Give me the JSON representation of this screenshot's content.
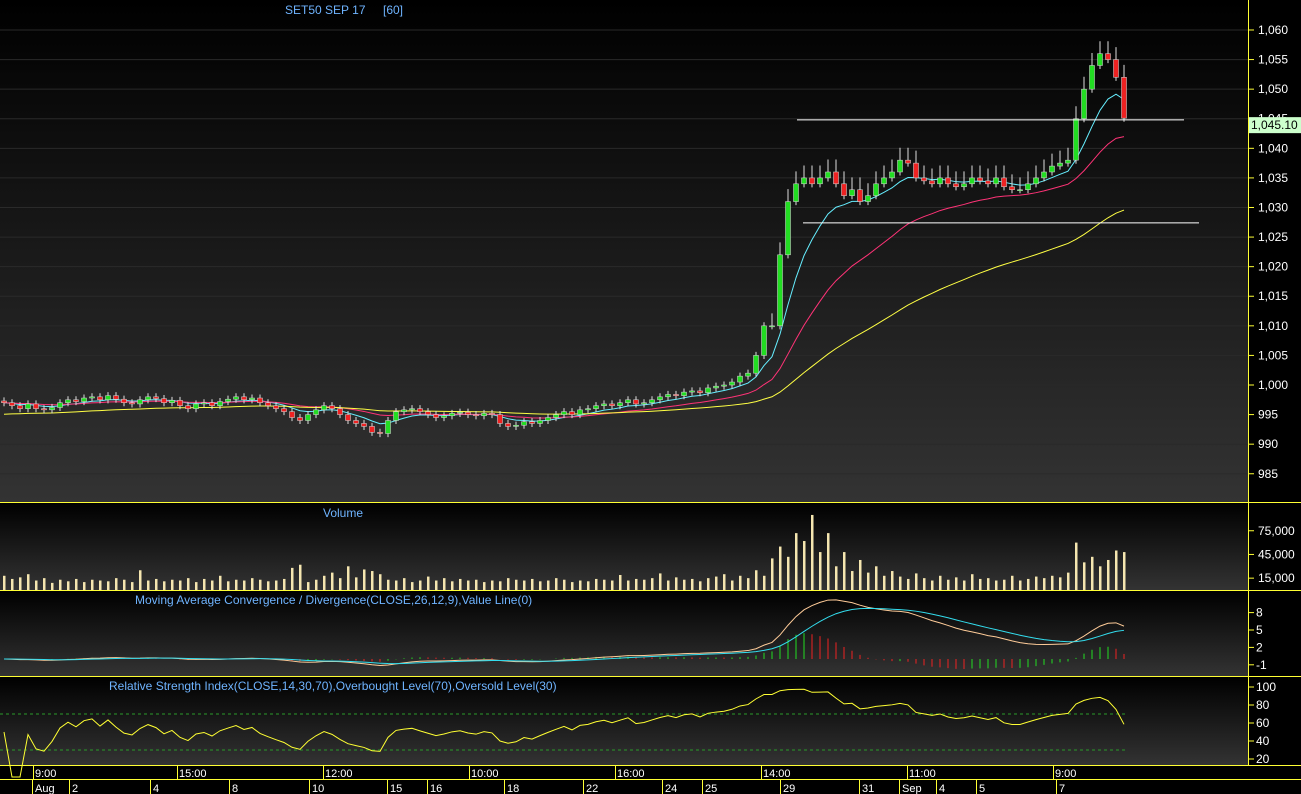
{
  "chart_data": {
    "type": "candlestick",
    "title": "SET50 SEP 17",
    "interval": "[60]",
    "price_axis": {
      "ticks": [
        "1,060",
        "1,055",
        "1,050",
        "1,045",
        "1,040",
        "1,035",
        "1,030",
        "1,025",
        "1,020",
        "1,015",
        "1,010",
        "1,005",
        "1,000",
        "995",
        "990",
        "985"
      ],
      "range": [
        978,
        1065
      ]
    },
    "last_price_label": "1,045.10",
    "last_price": 1045.1,
    "horizontal_lines": [
      1044.8,
      1027.4
    ],
    "closes": [
      997,
      996.5,
      996,
      996.8,
      996,
      995.8,
      996.2,
      997,
      997.5,
      997.2,
      997.8,
      998,
      997.5,
      998.2,
      997.6,
      997,
      996.8,
      997.5,
      998,
      997.7,
      997,
      997.4,
      996.5,
      996,
      996.8,
      997,
      996.5,
      997.2,
      997.6,
      998,
      997.5,
      997.8,
      997,
      996.5,
      996,
      995.5,
      994.5,
      994,
      995,
      995.8,
      996.5,
      996,
      995,
      994,
      993.5,
      993,
      992,
      991.8,
      994,
      995.5,
      995.8,
      996,
      995.5,
      995,
      994.5,
      994.8,
      995.2,
      995.4,
      995,
      994.8,
      995.2,
      995,
      993.5,
      993,
      993.2,
      993.8,
      993.5,
      994,
      994.5,
      995,
      995.5,
      995,
      995.8,
      996,
      996.5,
      996.8,
      996.5,
      997,
      997.5,
      996.8,
      997,
      997.5,
      998,
      998.4,
      998.2,
      998.8,
      999,
      998.7,
      999.5,
      999.8,
      1000,
      1000.5,
      1001.5,
      1002,
      1005,
      1010,
      1010,
      1022,
      1031,
      1034,
      1035,
      1034,
      1035,
      1036,
      1034,
      1032,
      1033,
      1031,
      1032,
      1034,
      1035,
      1036,
      1038,
      1037.5,
      1035,
      1034.5,
      1034,
      1035,
      1034,
      1033.5,
      1034,
      1035,
      1034.5,
      1034,
      1035,
      1033.5,
      1033,
      1033,
      1034,
      1035,
      1036,
      1037,
      1037.5,
      1038,
      1045,
      1050,
      1054,
      1056,
      1055,
      1052,
      1045.1
    ],
    "volume": {
      "label": "Volume",
      "ticks": [
        "75,000",
        "45,000",
        "15,000"
      ],
      "values": [
        18000,
        14000,
        16000,
        20000,
        12000,
        15000,
        9000,
        13000,
        11000,
        14000,
        10000,
        13000,
        12000,
        11000,
        15000,
        13000,
        10000,
        25000,
        12000,
        14000,
        11000,
        13000,
        12000,
        15000,
        10000,
        14000,
        12000,
        18000,
        11000,
        13000,
        12000,
        15000,
        13000,
        11000,
        12000,
        14000,
        28000,
        32000,
        10000,
        13000,
        18000,
        22000,
        15000,
        30000,
        16000,
        26000,
        24000,
        20000,
        13000,
        12000,
        15000,
        10000,
        12000,
        17000,
        12000,
        15000,
        11000,
        14000,
        12000,
        13000,
        10000,
        12000,
        11000,
        15000,
        13000,
        12000,
        14000,
        11000,
        12000,
        15000,
        13000,
        10000,
        12000,
        11000,
        14000,
        13000,
        12000,
        19000,
        12000,
        14000,
        13000,
        15000,
        21000,
        12000,
        16000,
        13000,
        14000,
        11000,
        15000,
        17000,
        20000,
        12000,
        18000,
        15000,
        25000,
        18000,
        40000,
        55000,
        42000,
        72000,
        62000,
        95000,
        48000,
        72000,
        30000,
        48000,
        24000,
        38000,
        22000,
        30000,
        18000,
        24000,
        17000,
        14000,
        21000,
        15000,
        12000,
        18000,
        13000,
        16000,
        12000,
        20000,
        14000,
        15000,
        12000,
        13000,
        18000,
        12000,
        14000,
        17000,
        15000,
        18000,
        16000,
        22000,
        60000,
        35000,
        42000,
        30000,
        38000,
        50000,
        48000
      ]
    },
    "macd": {
      "label": "Moving Average Convergence / Divergence(CLOSE,26,12,9),Value Line(0)",
      "ticks": [
        "8",
        "5",
        "2",
        "-1"
      ]
    },
    "rsi": {
      "label": "Relative Strength Index(CLOSE,14,30,70),Overbought Level(70),Oversold Level(30)",
      "ticks": [
        "100",
        "80",
        "60",
        "40",
        "20"
      ]
    },
    "time_axis": {
      "row1": [
        "9:00",
        "15:00",
        "12:00",
        "10:00",
        "16:00",
        "14:00",
        "11:00",
        "9:00"
      ],
      "row2": [
        "Aug",
        "2",
        "4",
        "8",
        "10",
        "15",
        "16",
        "18",
        "22",
        "24",
        "25",
        "29",
        "31",
        "Sep",
        "4",
        "5",
        "7"
      ]
    },
    "colors": {
      "up": "#22dd22",
      "down": "#ee2222",
      "ma_fast": "#66eeff",
      "ma_mid": "#ff3377",
      "ma_slow": "#ffff44",
      "axis": "#ffff33",
      "label": "#6fb4ff",
      "last_bg": "#ccffcc"
    }
  }
}
